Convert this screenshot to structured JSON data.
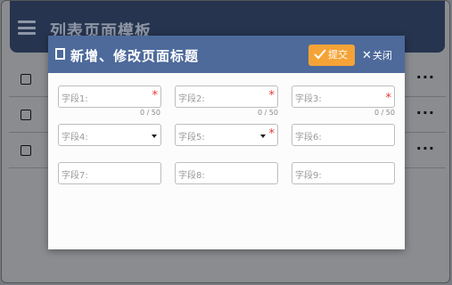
{
  "app": {
    "title": "列表页面模板"
  },
  "background_rows": [
    {
      "more": "···"
    },
    {
      "more": "···"
    },
    {
      "more": "···"
    }
  ],
  "dialog": {
    "title": "新增、修改页面标题",
    "submit_label": "提交",
    "close_label": "关闭",
    "required_mark": "*",
    "fields": {
      "f1": {
        "label": "字段1:",
        "counter": "0 / 50"
      },
      "f2": {
        "label": "字段2:",
        "counter": "0 / 50"
      },
      "f3": {
        "label": "字段3:",
        "counter": "0 / 50"
      },
      "f4": {
        "label": "字段4:"
      },
      "f5": {
        "label": "字段5:"
      },
      "f6": {
        "label": "字段6:"
      },
      "f7": {
        "label": "字段7:"
      },
      "f8": {
        "label": "字段8:"
      },
      "f9": {
        "label": "字段9:"
      }
    }
  },
  "colors": {
    "header": "#26344f",
    "dialog_header": "#4d6a9b",
    "accent": "#f5a336",
    "required": "#e53935"
  }
}
